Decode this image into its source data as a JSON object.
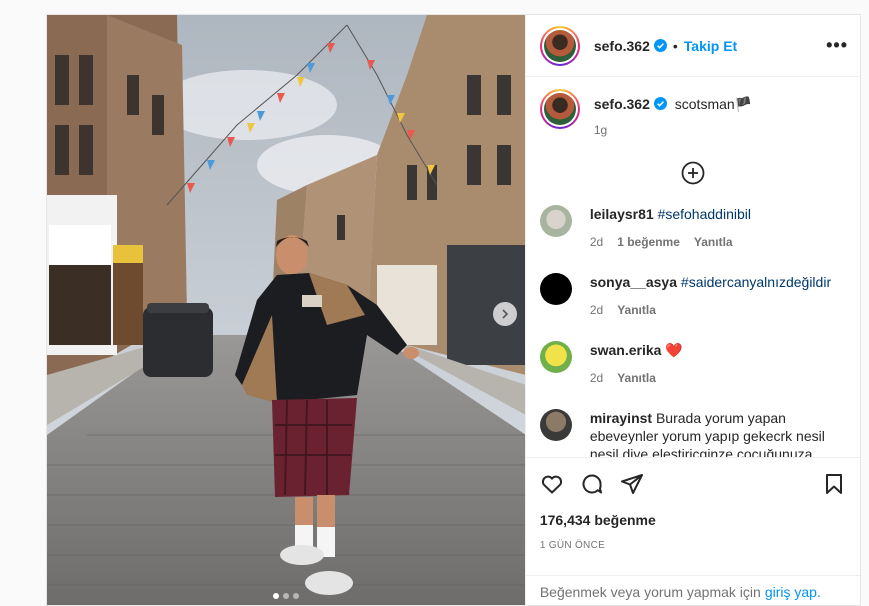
{
  "header": {
    "username": "sefo.362",
    "separator": "•",
    "follow_label": "Takip Et",
    "more_label": "•••"
  },
  "caption": {
    "username": "sefo.362",
    "text": "scotsman🏴",
    "age": "1g"
  },
  "comments": [
    {
      "username": "leilaysr81",
      "text": "#sefohaddinibil",
      "age": "2d",
      "likes": "1 beğenme",
      "reply": "Yanıtla"
    },
    {
      "username": "sonya__asya",
      "text": "#saidercanyalnızdeğildir",
      "age": "2d",
      "reply": "Yanıtla"
    },
    {
      "username": "swan.erika",
      "text": "❤️",
      "age": "2d",
      "reply": "Yanıtla"
    },
    {
      "username": "mirayinst",
      "text": "Burada yorum yapan ebeveynler yorum yapıp gekecrk nesil nesil diye elestiricginze çocuğunuza"
    }
  ],
  "post": {
    "likes": "176,434 beğenme",
    "date": "1 GÜN ÖNCE"
  },
  "login_bar": {
    "prompt": "Beğenmek veya yorum yapmak için",
    "link": "giriş yap."
  },
  "icons": [
    "verified-badge-icon",
    "more-options-icon",
    "add-circle-icon",
    "like-heart-icon",
    "comment-icon",
    "share-icon",
    "save-bookmark-icon",
    "chevron-right-icon"
  ],
  "colors": {
    "accent": "#0095f6",
    "hashtag": "#00376b",
    "heart": "#ed4956",
    "muted": "#737373"
  },
  "carousel": {
    "current": 1,
    "total": 3
  }
}
